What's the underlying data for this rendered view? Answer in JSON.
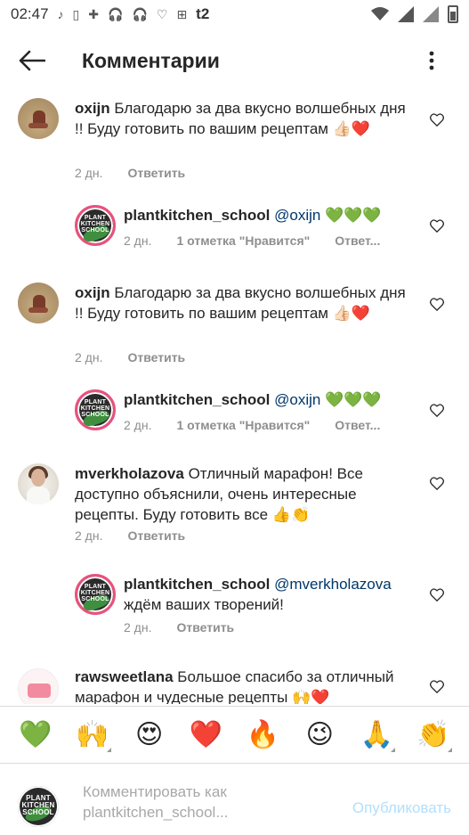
{
  "status_bar": {
    "time": "02:47",
    "carrier": "t2",
    "left_icons": [
      "music-note-icon",
      "sim-card-icon",
      "battery-saver-icon",
      "headset-icon",
      "headset-icon",
      "heart-outline-icon",
      "plus-square-icon"
    ],
    "right_icons": [
      "wifi-icon",
      "signal-icon",
      "signal-icon",
      "battery-icon"
    ]
  },
  "header": {
    "title": "Комментарии"
  },
  "comments": [
    {
      "user": "oxijn",
      "text": "Благодарю за два вкусно волшебных дня !! Буду готовить по вашим рецептам",
      "emojis": "👍🏻❤️",
      "time": "2 дн.",
      "reply": "Ответить"
    },
    {
      "user": "plantkitchen_school",
      "mention": "@oxijn",
      "text": "💚💚💚",
      "time": "2 дн.",
      "likes": "1 отметка \"Нравится\"",
      "reply": "Ответ..."
    },
    {
      "user": "oxijn",
      "text": "Благодарю за два вкусно волшебных дня !! Буду готовить по вашим рецептам",
      "emojis": "👍🏻❤️",
      "time": "2 дн.",
      "reply": "Ответить"
    },
    {
      "user": "plantkitchen_school",
      "mention": "@oxijn",
      "text": "💚💚💚",
      "time": "2 дн.",
      "likes": "1 отметка \"Нравится\"",
      "reply": "Ответ..."
    },
    {
      "user": "mverkholazova",
      "text": "Отличный марафон! Все доступно объяснили, очень интересные рецепты. Буду готовить все 👍👏",
      "time": "2 дн.",
      "reply": "Ответить"
    },
    {
      "user": "plantkitchen_school",
      "mention": "@mverkholazova",
      "text": "ждём ваших творений!",
      "time": "2 дн.",
      "reply": "Ответить"
    },
    {
      "user": "rawsweetlana",
      "text": "Большое спасибо за отличный марафон и чудесные рецепты 🙌❤️"
    }
  ],
  "school_avatar_text": "PLANT KITCHEN SCHOOL",
  "emoji_bar": [
    "💚",
    "🙌",
    "😍",
    "❤️",
    "🔥",
    "😉",
    "🙏",
    "👏"
  ],
  "composer": {
    "placeholder": "Комментировать как plantkitchen_school...",
    "publish": "Опубликовать"
  },
  "colors": {
    "text": "#262626",
    "meta": "#8e8e8e",
    "mention": "#00376b",
    "publish_disabled": "#b2dffc",
    "school_ring": "#e8527d"
  }
}
